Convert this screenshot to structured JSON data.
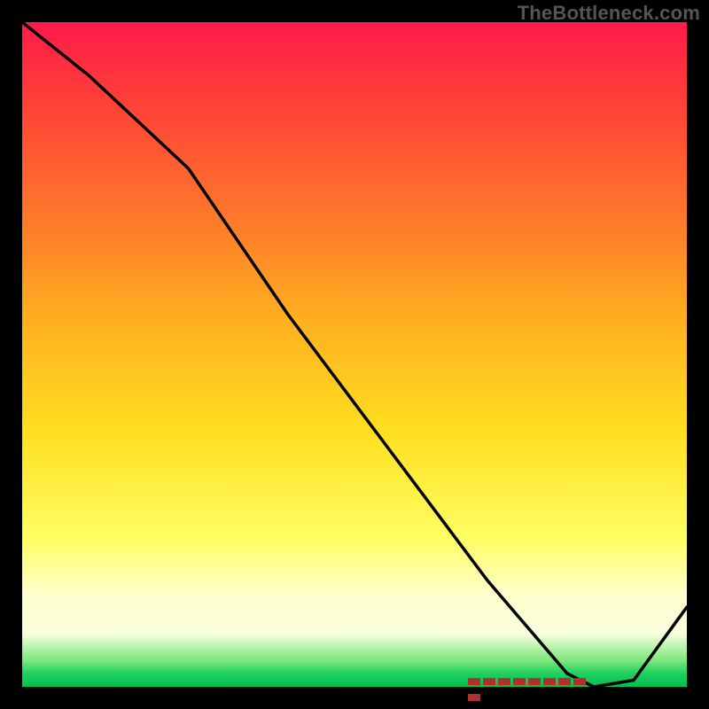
{
  "watermark": "TheBottleneck.com",
  "chart_data": {
    "type": "line",
    "title": "",
    "xlabel": "",
    "ylabel": "",
    "xlim": [
      0,
      100
    ],
    "ylim": [
      0,
      100
    ],
    "grid": false,
    "legend": false,
    "series": [
      {
        "name": "bottleneck-curve",
        "x": [
          0,
          10,
          25,
          40,
          55,
          70,
          82,
          86,
          92,
          100
        ],
        "values": [
          100,
          92,
          78,
          56,
          36,
          16,
          2,
          0,
          1,
          12
        ]
      }
    ],
    "annotations": [
      {
        "name": "target-range-marker",
        "x_start": 67,
        "x_end": 87,
        "y": 1.5,
        "style": "dashed",
        "color": "#b03030"
      }
    ],
    "background_gradient": {
      "direction": "vertical",
      "stops": [
        {
          "pos": 0.0,
          "color": "#ff1a4a"
        },
        {
          "pos": 0.1,
          "color": "#ff3a3a"
        },
        {
          "pos": 0.3,
          "color": "#ff7a2a"
        },
        {
          "pos": 0.45,
          "color": "#ffb020"
        },
        {
          "pos": 0.62,
          "color": "#ffe020"
        },
        {
          "pos": 0.78,
          "color": "#ffff66"
        },
        {
          "pos": 0.86,
          "color": "#ffffcc"
        },
        {
          "pos": 0.92,
          "color": "#f8ffdd"
        },
        {
          "pos": 0.96,
          "color": "#7de87d"
        },
        {
          "pos": 0.98,
          "color": "#20d060"
        },
        {
          "pos": 1.0,
          "color": "#00c050"
        }
      ]
    }
  }
}
